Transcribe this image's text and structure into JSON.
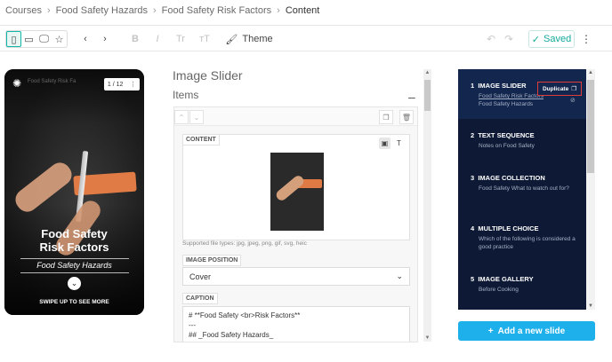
{
  "breadcrumb": {
    "items": [
      "Courses",
      "Food Safety Hazards",
      "Food Safety Risk Factors"
    ],
    "current": "Content",
    "separator": "›"
  },
  "toolbar": {
    "theme_label": "Theme",
    "saved_label": "Saved",
    "format_bold": "B",
    "format_italic": "I",
    "format_t1": "Tr",
    "format_t2": "ᴛT"
  },
  "preview": {
    "counter": "1 / 12",
    "brand_text": "Food Safety Risk Fa",
    "title_line1": "Food Safety",
    "title_line2": "Risk Factors",
    "subtitle": "Food Safety Hazards",
    "swipe_text": "SWIPE UP TO SEE MORE"
  },
  "editor": {
    "panel_title": "Image Slider",
    "items_label": "Items",
    "content_label": "CONTENT",
    "file_types": "Supported file types: jpg, jpeg, png, gif, svg, heic",
    "image_position_label": "IMAGE POSITION",
    "image_position_value": "Cover",
    "caption_label": "CAPTION",
    "caption_lines": [
      "# **Food Safety <br>Risk Factors**",
      "---",
      "## _Food Safety Hazards_"
    ]
  },
  "slides": [
    {
      "num": "1",
      "title": "IMAGE SLIDER",
      "sub": "Food Safety Risk Factors",
      "sub2": "Food Safety Hazards"
    },
    {
      "num": "2",
      "title": "TEXT SEQUENCE",
      "sub": "Notes on Food Safety"
    },
    {
      "num": "3",
      "title": "IMAGE COLLECTION",
      "sub": "Food Safety What to watch out for?"
    },
    {
      "num": "4",
      "title": "MULTIPLE CHOICE",
      "sub": "Which of the following is considered a good practice"
    },
    {
      "num": "5",
      "title": "IMAGE GALLERY",
      "sub": "Before Cooking"
    }
  ],
  "duplicate_label": "Duplicate",
  "add_slide_label": "Add a new slide",
  "colors": {
    "accent": "#13b5a6",
    "slides_bg": "#0e1a35",
    "add_button": "#1db0ea",
    "highlight_border": "#e03b3b"
  }
}
